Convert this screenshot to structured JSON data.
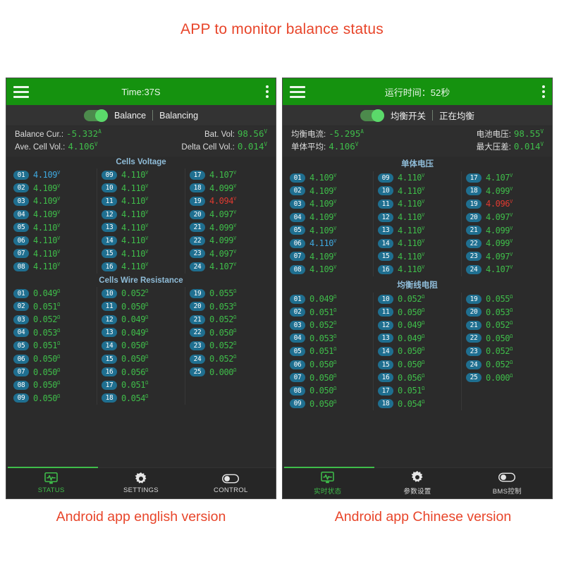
{
  "heading": "APP to monitor balance status",
  "captions": {
    "left": "Android app english version",
    "right": "Android app Chinese version"
  },
  "colors": {
    "accent_green": "#3fbd4a",
    "appbar_green": "#15920f",
    "title_red": "#e8452a",
    "index_blue": "#1f6f90",
    "section_blue": "#8fbcd8",
    "low_red": "#e03a30",
    "high_blue": "#3fa9e0",
    "panel_bg": "#2b2b2b"
  },
  "apps": [
    {
      "id": "english",
      "appbar": {
        "menu_icon": "hamburger-icon",
        "title": "Time:37S",
        "overflow_icon": "kebab-menu-icon"
      },
      "toggle": {
        "switch_on": true,
        "label": "Balance",
        "state": "Balancing"
      },
      "summary": [
        {
          "label": "Balance Cur.:",
          "value": "-5.332",
          "unit": "A",
          "label2": "Bat. Vol:",
          "value2": "98.56",
          "unit2": "V"
        },
        {
          "label": "Ave. Cell Vol.:",
          "value": "4.106",
          "unit": "V",
          "label2": "Delta Cell Vol.:",
          "value2": "0.014",
          "unit2": "V"
        }
      ],
      "voltage": {
        "title": "Cells Voltage",
        "unit": "V",
        "columns": [
          [
            {
              "idx": "01",
              "val": "4.109",
              "state": "hi"
            },
            {
              "idx": "02",
              "val": "4.109",
              "state": "ok"
            },
            {
              "idx": "03",
              "val": "4.109",
              "state": "ok"
            },
            {
              "idx": "04",
              "val": "4.109",
              "state": "ok"
            },
            {
              "idx": "05",
              "val": "4.110",
              "state": "ok"
            },
            {
              "idx": "06",
              "val": "4.110",
              "state": "ok"
            },
            {
              "idx": "07",
              "val": "4.110",
              "state": "ok"
            },
            {
              "idx": "08",
              "val": "4.110",
              "state": "ok"
            }
          ],
          [
            {
              "idx": "09",
              "val": "4.110",
              "state": "ok"
            },
            {
              "idx": "10",
              "val": "4.110",
              "state": "ok"
            },
            {
              "idx": "11",
              "val": "4.110",
              "state": "ok"
            },
            {
              "idx": "12",
              "val": "4.110",
              "state": "ok"
            },
            {
              "idx": "13",
              "val": "4.110",
              "state": "ok"
            },
            {
              "idx": "14",
              "val": "4.110",
              "state": "ok"
            },
            {
              "idx": "15",
              "val": "4.110",
              "state": "ok"
            },
            {
              "idx": "16",
              "val": "4.110",
              "state": "ok"
            }
          ],
          [
            {
              "idx": "17",
              "val": "4.107",
              "state": "ok"
            },
            {
              "idx": "18",
              "val": "4.099",
              "state": "ok"
            },
            {
              "idx": "19",
              "val": "4.094",
              "state": "low"
            },
            {
              "idx": "20",
              "val": "4.097",
              "state": "ok"
            },
            {
              "idx": "21",
              "val": "4.099",
              "state": "ok"
            },
            {
              "idx": "22",
              "val": "4.099",
              "state": "ok"
            },
            {
              "idx": "23",
              "val": "4.097",
              "state": "ok"
            },
            {
              "idx": "24",
              "val": "4.107",
              "state": "ok"
            }
          ]
        ]
      },
      "resistance": {
        "title": "Cells Wire Resistance",
        "unit": "Ω",
        "columns": [
          [
            {
              "idx": "01",
              "val": "0.049",
              "state": "ok"
            },
            {
              "idx": "02",
              "val": "0.051",
              "state": "ok"
            },
            {
              "idx": "03",
              "val": "0.052",
              "state": "ok"
            },
            {
              "idx": "04",
              "val": "0.053",
              "state": "ok"
            },
            {
              "idx": "05",
              "val": "0.051",
              "state": "ok"
            },
            {
              "idx": "06",
              "val": "0.050",
              "state": "ok"
            },
            {
              "idx": "07",
              "val": "0.050",
              "state": "ok"
            },
            {
              "idx": "08",
              "val": "0.050",
              "state": "ok"
            },
            {
              "idx": "09",
              "val": "0.050",
              "state": "ok"
            }
          ],
          [
            {
              "idx": "10",
              "val": "0.052",
              "state": "ok"
            },
            {
              "idx": "11",
              "val": "0.050",
              "state": "ok"
            },
            {
              "idx": "12",
              "val": "0.049",
              "state": "ok"
            },
            {
              "idx": "13",
              "val": "0.049",
              "state": "ok"
            },
            {
              "idx": "14",
              "val": "0.050",
              "state": "ok"
            },
            {
              "idx": "15",
              "val": "0.050",
              "state": "ok"
            },
            {
              "idx": "16",
              "val": "0.056",
              "state": "ok"
            },
            {
              "idx": "17",
              "val": "0.051",
              "state": "ok"
            },
            {
              "idx": "18",
              "val": "0.054",
              "state": "ok"
            }
          ],
          [
            {
              "idx": "19",
              "val": "0.055",
              "state": "ok"
            },
            {
              "idx": "20",
              "val": "0.053",
              "state": "ok"
            },
            {
              "idx": "21",
              "val": "0.052",
              "state": "ok"
            },
            {
              "idx": "22",
              "val": "0.050",
              "state": "ok"
            },
            {
              "idx": "23",
              "val": "0.052",
              "state": "ok"
            },
            {
              "idx": "24",
              "val": "0.052",
              "state": "ok"
            },
            {
              "idx": "25",
              "val": "0.000",
              "state": "ok"
            }
          ]
        ]
      },
      "nav": [
        {
          "label": "STATUS",
          "icon": "monitor-pulse-icon",
          "active": true
        },
        {
          "label": "SETTINGS",
          "icon": "gear-icon",
          "active": false
        },
        {
          "label": "CONTROL",
          "icon": "toggle-switch-icon",
          "active": false
        }
      ]
    },
    {
      "id": "chinese",
      "appbar": {
        "menu_icon": "hamburger-icon",
        "title": "运行时间：52秒",
        "overflow_icon": "kebab-menu-icon"
      },
      "toggle": {
        "switch_on": true,
        "label": "均衡开关",
        "state": "正在均衡"
      },
      "summary": [
        {
          "label": "均衡电流:",
          "value": "-5.295",
          "unit": "A",
          "label2": "电池电压:",
          "value2": "98.55",
          "unit2": "V"
        },
        {
          "label": "单体平均:",
          "value": "4.106",
          "unit": "V",
          "label2": "最大压差:",
          "value2": "0.014",
          "unit2": "V"
        }
      ],
      "voltage": {
        "title": "单体电压",
        "unit": "V",
        "columns": [
          [
            {
              "idx": "01",
              "val": "4.109",
              "state": "ok"
            },
            {
              "idx": "02",
              "val": "4.109",
              "state": "ok"
            },
            {
              "idx": "03",
              "val": "4.109",
              "state": "ok"
            },
            {
              "idx": "04",
              "val": "4.109",
              "state": "ok"
            },
            {
              "idx": "05",
              "val": "4.109",
              "state": "ok"
            },
            {
              "idx": "06",
              "val": "4.110",
              "state": "hi"
            },
            {
              "idx": "07",
              "val": "4.109",
              "state": "ok"
            },
            {
              "idx": "08",
              "val": "4.109",
              "state": "ok"
            }
          ],
          [
            {
              "idx": "09",
              "val": "4.110",
              "state": "ok"
            },
            {
              "idx": "10",
              "val": "4.110",
              "state": "ok"
            },
            {
              "idx": "11",
              "val": "4.110",
              "state": "ok"
            },
            {
              "idx": "12",
              "val": "4.110",
              "state": "ok"
            },
            {
              "idx": "13",
              "val": "4.110",
              "state": "ok"
            },
            {
              "idx": "14",
              "val": "4.110",
              "state": "ok"
            },
            {
              "idx": "15",
              "val": "4.110",
              "state": "ok"
            },
            {
              "idx": "16",
              "val": "4.110",
              "state": "ok"
            }
          ],
          [
            {
              "idx": "17",
              "val": "4.107",
              "state": "ok"
            },
            {
              "idx": "18",
              "val": "4.099",
              "state": "ok"
            },
            {
              "idx": "19",
              "val": "4.096",
              "state": "low"
            },
            {
              "idx": "20",
              "val": "4.097",
              "state": "ok"
            },
            {
              "idx": "21",
              "val": "4.099",
              "state": "ok"
            },
            {
              "idx": "22",
              "val": "4.099",
              "state": "ok"
            },
            {
              "idx": "23",
              "val": "4.097",
              "state": "ok"
            },
            {
              "idx": "24",
              "val": "4.107",
              "state": "ok"
            }
          ]
        ]
      },
      "resistance": {
        "title": "均衡线电阻",
        "unit": "Ω",
        "columns": [
          [
            {
              "idx": "01",
              "val": "0.049",
              "state": "ok"
            },
            {
              "idx": "02",
              "val": "0.051",
              "state": "ok"
            },
            {
              "idx": "03",
              "val": "0.052",
              "state": "ok"
            },
            {
              "idx": "04",
              "val": "0.053",
              "state": "ok"
            },
            {
              "idx": "05",
              "val": "0.051",
              "state": "ok"
            },
            {
              "idx": "06",
              "val": "0.050",
              "state": "ok"
            },
            {
              "idx": "07",
              "val": "0.050",
              "state": "ok"
            },
            {
              "idx": "08",
              "val": "0.050",
              "state": "ok"
            },
            {
              "idx": "09",
              "val": "0.050",
              "state": "ok"
            }
          ],
          [
            {
              "idx": "10",
              "val": "0.052",
              "state": "ok"
            },
            {
              "idx": "11",
              "val": "0.050",
              "state": "ok"
            },
            {
              "idx": "12",
              "val": "0.049",
              "state": "ok"
            },
            {
              "idx": "13",
              "val": "0.049",
              "state": "ok"
            },
            {
              "idx": "14",
              "val": "0.050",
              "state": "ok"
            },
            {
              "idx": "15",
              "val": "0.050",
              "state": "ok"
            },
            {
              "idx": "16",
              "val": "0.056",
              "state": "ok"
            },
            {
              "idx": "17",
              "val": "0.051",
              "state": "ok"
            },
            {
              "idx": "18",
              "val": "0.054",
              "state": "ok"
            }
          ],
          [
            {
              "idx": "19",
              "val": "0.055",
              "state": "ok"
            },
            {
              "idx": "20",
              "val": "0.053",
              "state": "ok"
            },
            {
              "idx": "21",
              "val": "0.052",
              "state": "ok"
            },
            {
              "idx": "22",
              "val": "0.050",
              "state": "ok"
            },
            {
              "idx": "23",
              "val": "0.052",
              "state": "ok"
            },
            {
              "idx": "24",
              "val": "0.052",
              "state": "ok"
            },
            {
              "idx": "25",
              "val": "0.000",
              "state": "ok"
            }
          ]
        ]
      },
      "nav": [
        {
          "label": "实时状态",
          "icon": "monitor-pulse-icon",
          "active": true
        },
        {
          "label": "参数设置",
          "icon": "gear-icon",
          "active": false
        },
        {
          "label": "BMS控制",
          "icon": "toggle-switch-icon",
          "active": false
        }
      ]
    }
  ]
}
